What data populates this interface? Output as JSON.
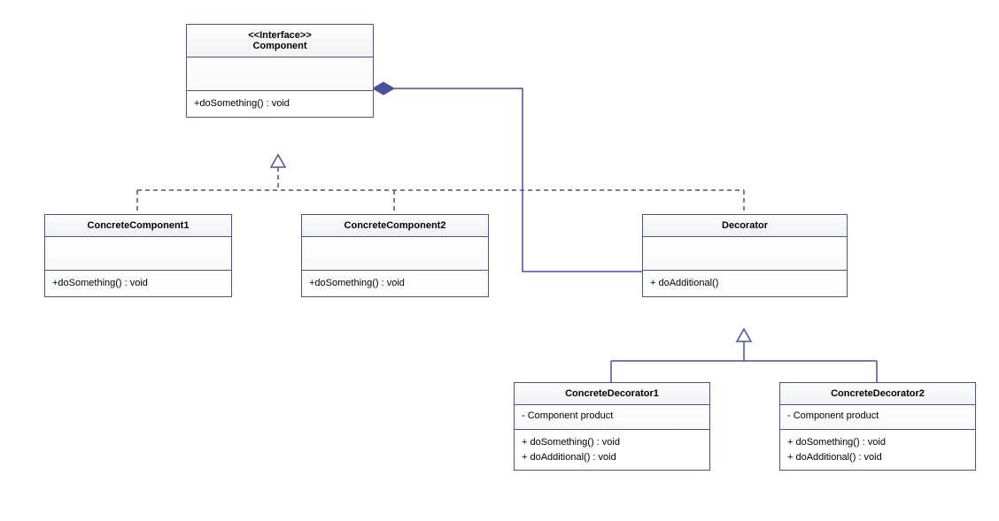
{
  "classes": {
    "component": {
      "stereotype": "<<Interface>>",
      "name": "Component",
      "attributes": "",
      "operations": [
        "+doSomething() : void"
      ]
    },
    "concreteComponent1": {
      "name": "ConcreteComponent1",
      "attributes": "",
      "operations": [
        "+doSomething() : void"
      ]
    },
    "concreteComponent2": {
      "name": "ConcreteComponent2",
      "attributes": "",
      "operations": [
        "+doSomething() : void"
      ]
    },
    "decorator": {
      "name": "Decorator",
      "attributes": "",
      "operations": [
        "+ doAdditional()"
      ]
    },
    "concreteDecorator1": {
      "name": "ConcreteDecorator1",
      "attributes": "- Component product",
      "operations": [
        "+ doSomething() : void",
        "+ doAdditional() : void"
      ]
    },
    "concreteDecorator2": {
      "name": "ConcreteDecorator2",
      "attributes": "- Component product",
      "operations": [
        "+ doSomething() : void",
        "+ doAdditional() : void"
      ]
    }
  },
  "relations": [
    {
      "from": "concreteComponent1",
      "to": "component",
      "type": "realization"
    },
    {
      "from": "concreteComponent2",
      "to": "component",
      "type": "realization"
    },
    {
      "from": "decorator",
      "to": "component",
      "type": "realization"
    },
    {
      "from": "concreteDecorator1",
      "to": "decorator",
      "type": "generalization"
    },
    {
      "from": "concreteDecorator2",
      "to": "decorator",
      "type": "generalization"
    },
    {
      "from": "component",
      "to": "decorator",
      "type": "composition"
    }
  ]
}
